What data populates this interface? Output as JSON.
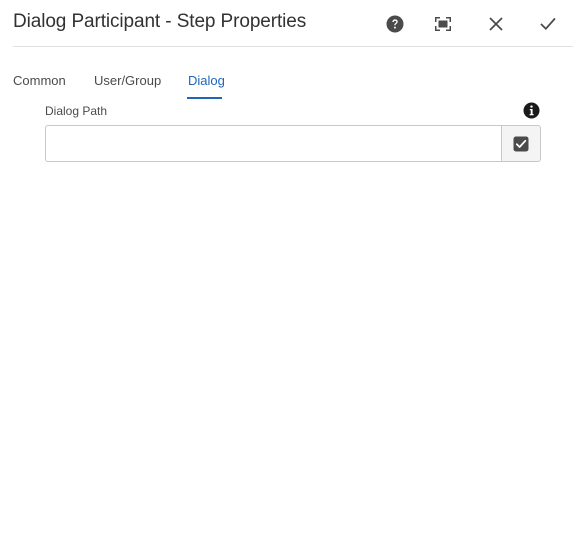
{
  "dialog": {
    "title": "Dialog Participant - Step Properties"
  },
  "header_actions": {
    "help_icon": "help-icon",
    "fullscreen_icon": "fullscreen-icon",
    "close_icon": "close-icon",
    "done_icon": "checkmark-icon"
  },
  "tabs": [
    {
      "label": "Common",
      "active": false
    },
    {
      "label": "User/Group",
      "active": false
    },
    {
      "label": "Dialog",
      "active": true
    }
  ],
  "dialog_path": {
    "label": "Dialog Path",
    "value": "",
    "placeholder": "",
    "info_icon": "info-icon",
    "picker_icon": "checkbox-icon"
  },
  "colors": {
    "active_tab": "#1f66b8",
    "icon": "#4b4b4b",
    "border": "#c8c8c8"
  }
}
